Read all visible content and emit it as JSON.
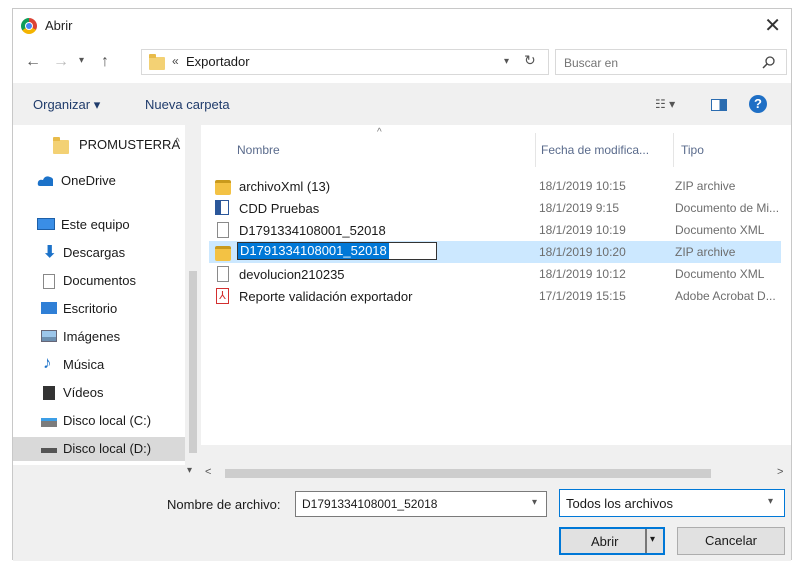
{
  "window": {
    "title": "Abrir"
  },
  "address": {
    "prefix": "«",
    "path": "Exportador"
  },
  "search": {
    "placeholder": "Buscar en"
  },
  "toolbar": {
    "organize": "Organizar ▾",
    "new_folder": "Nueva carpeta",
    "view_icon": "view-options-icon",
    "help_icon": "help-icon"
  },
  "sidebar": {
    "items": [
      {
        "label": "PROMUSTERRA",
        "icon": "folder-icon"
      },
      {
        "label": "OneDrive",
        "icon": "cloud-icon"
      },
      {
        "label": "Este equipo",
        "icon": "computer-icon"
      },
      {
        "label": "Descargas",
        "icon": "download-icon"
      },
      {
        "label": "Documentos",
        "icon": "document-icon"
      },
      {
        "label": "Escritorio",
        "icon": "desktop-icon"
      },
      {
        "label": "Imágenes",
        "icon": "image-icon"
      },
      {
        "label": "Música",
        "icon": "music-icon"
      },
      {
        "label": "Vídeos",
        "icon": "video-icon"
      },
      {
        "label": "Disco local (C:)",
        "icon": "drive-icon"
      },
      {
        "label": "Disco local (D:)",
        "icon": "drive-icon"
      }
    ],
    "selected_index": 10
  },
  "columns": {
    "name": "Nombre",
    "date": "Fecha de modifica...",
    "type": "Tipo"
  },
  "files": [
    {
      "name": "archivoXml (13)",
      "date": "18/1/2019 10:15",
      "type": "ZIP archive",
      "icon": "zip-icon"
    },
    {
      "name": "CDD Pruebas",
      "date": "18/1/2019 9:15",
      "type": "Documento de Mi...",
      "icon": "word-icon"
    },
    {
      "name": "D1791334108001_52018",
      "date": "18/1/2019 10:19",
      "type": "Documento XML",
      "icon": "xml-icon"
    },
    {
      "name": "D1791334108001_52018",
      "date": "18/1/2019 10:20",
      "type": "ZIP archive",
      "icon": "zip-icon"
    },
    {
      "name": "devolucion210235",
      "date": "18/1/2019 10:12",
      "type": "Documento XML",
      "icon": "xml-icon"
    },
    {
      "name": "Reporte validación exportador",
      "date": "17/1/2019 15:15",
      "type": "Adobe Acrobat D...",
      "icon": "pdf-icon"
    }
  ],
  "selected_file_index": 3,
  "footer": {
    "filename_label": "Nombre de archivo:",
    "filename_value": "D1791334108001_52018",
    "filter_value": "Todos los archivos",
    "open_label": "Abrir",
    "cancel_label": "Cancelar"
  }
}
